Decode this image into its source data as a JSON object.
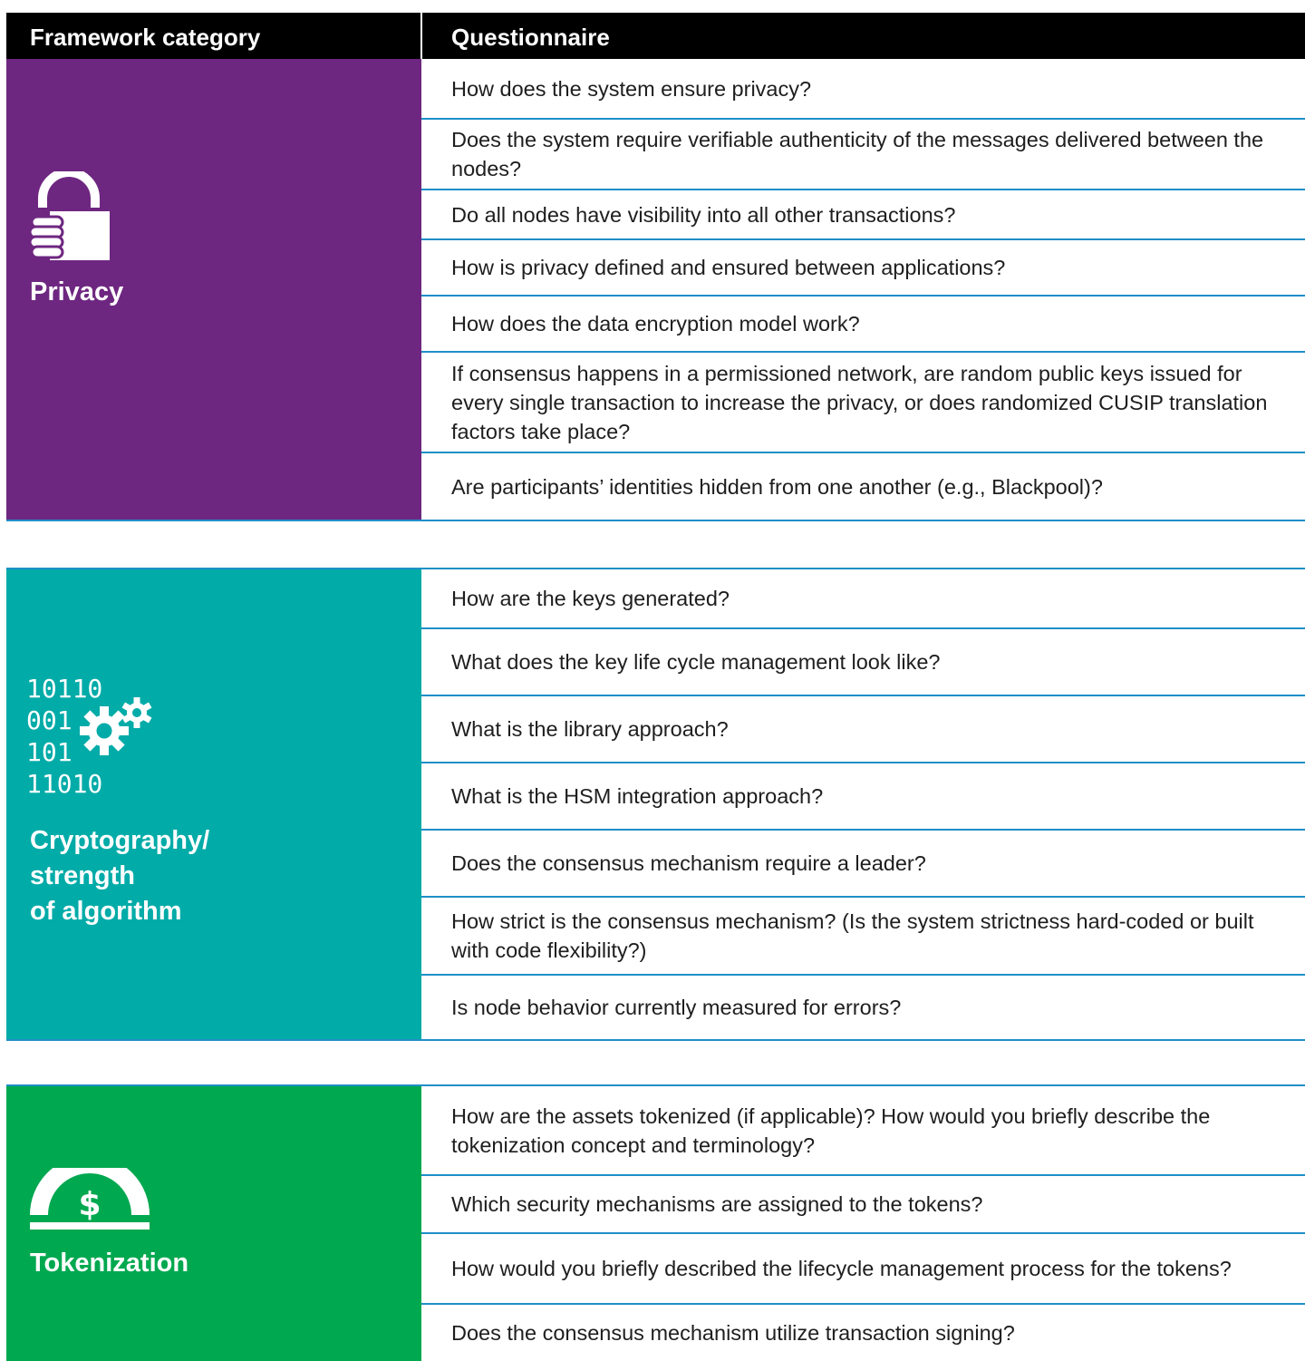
{
  "header": {
    "category_label": "Framework category",
    "questionnaire_label": "Questionnaire"
  },
  "colors": {
    "privacy": "#6e2780",
    "cryptography": "#00aba8",
    "tokenization": "#00a84f",
    "rule": "#1f8fc8"
  },
  "sections": [
    {
      "category": "Privacy",
      "icon": "padlock-hand-icon",
      "questions": [
        "How does the system ensure privacy?",
        "Does the system require verifiable authenticity of the messages delivered between the nodes?",
        "Do all nodes have visibility into all other transactions?",
        "How is privacy defined and ensured between applications?",
        "How does the data encryption model work?",
        "If consensus happens in a permissioned network, are random public keys issued for every single transaction to increase the privacy, or does randomized CUSIP translation factors take place?",
        "Are participants’ identities hidden from one another (e.g., Blackpool)?"
      ]
    },
    {
      "category": "Cryptography/ strength of algorithm",
      "category_lines": [
        "Cryptography/",
        "strength",
        "of algorithm"
      ],
      "icon": "binary-gears-icon",
      "binary_lines": [
        "10110",
        "001",
        "101",
        "11010"
      ],
      "questions": [
        "How are the keys generated?",
        "What does the key life cycle management look like?",
        "What is the library approach?",
        "What is the HSM integration approach?",
        "Does the consensus mechanism require a leader?",
        "How strict is the consensus mechanism? (Is the system strictness hard-coded or built with code flexibility?)",
        "Is node behavior currently measured for errors?"
      ]
    },
    {
      "category": "Tokenization",
      "icon": "dollar-token-icon",
      "questions": [
        "How are the assets tokenized (if applicable)? How would you briefly describe the tokenization concept and terminology?",
        "Which security mechanisms are assigned to the tokens?",
        "How would you briefly described the lifecycle management process for the tokens?",
        "Does the consensus mechanism utilize transaction signing?"
      ]
    }
  ]
}
